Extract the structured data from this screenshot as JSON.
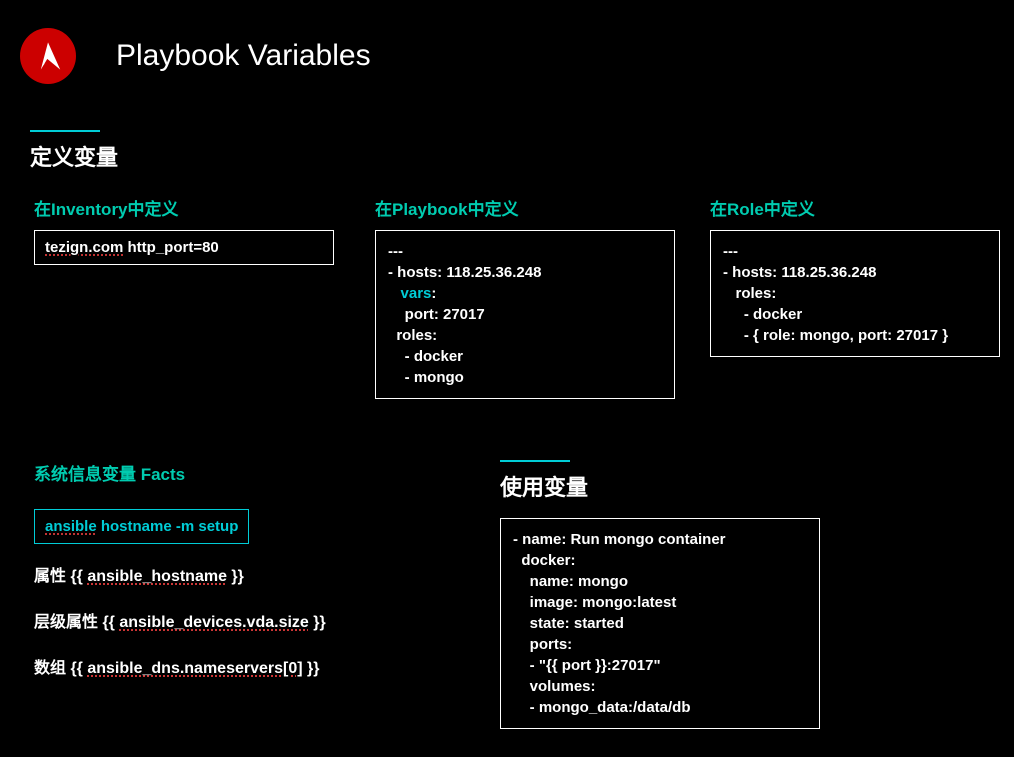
{
  "header": {
    "title": "Playbook Variables"
  },
  "sections": {
    "define": "定义变量",
    "use": "使用变量"
  },
  "inventory": {
    "heading": "在Inventory中定义",
    "host": "tezign.com",
    "rest": " http_port=80"
  },
  "playbook": {
    "heading": "在Playbook中定义",
    "l1": "---",
    "l2": "- hosts: 118.25.36.248",
    "l3a": "   ",
    "l3b": "vars",
    "l3c": ":",
    "l4": "    port: 27017",
    "l5": "  roles:",
    "l6": "    - docker",
    "l7": "    - mongo"
  },
  "role": {
    "heading": "在Role中定义",
    "l1": "---",
    "l2": "- hosts: 118.25.36.248",
    "l3": "   roles:",
    "l4": "     - docker",
    "l5": "     - { role: mongo, port: 27017 }"
  },
  "facts": {
    "heading": "系统信息变量 Facts",
    "cmd_a": "ansible",
    "cmd_b": " hostname -m setup",
    "attr_label": "属性 {{ ",
    "attr_var": "ansible_hostname",
    "attr_close": " }}",
    "nest_label": "层级属性 {{ ",
    "nest_var": "ansible_devices.vda.size",
    "nest_close": " }}",
    "arr_label": "数组 {{ ",
    "arr_var": "ansible_dns.nameservers[0]",
    "arr_close": " }}"
  },
  "usage": {
    "l1": "- name: Run mongo container",
    "l2": "  docker:",
    "l3": "    name: mongo",
    "l4": "    image: mongo:latest",
    "l5": "    state: started",
    "l6": "    ports:",
    "l7": "    - \"{{ port }}:27017\"",
    "l8": "    volumes:",
    "l9": "    - mongo_data:/data/db"
  }
}
